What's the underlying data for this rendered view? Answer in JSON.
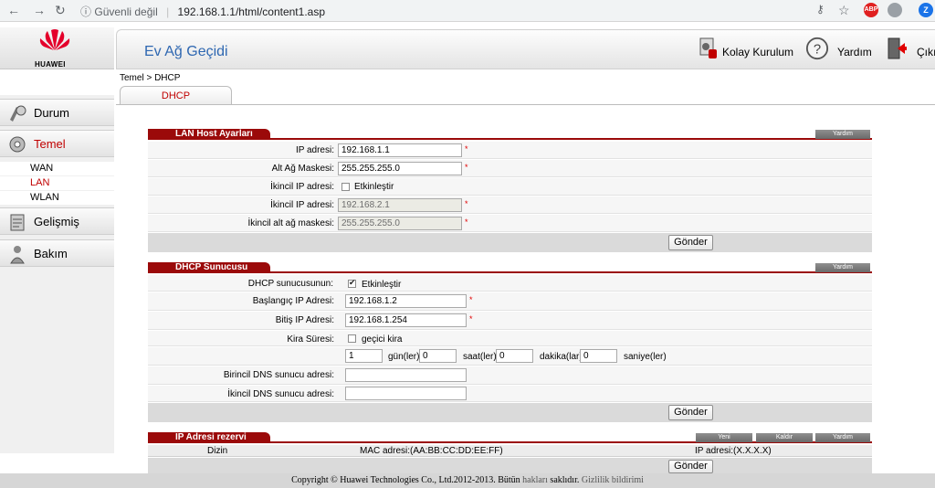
{
  "browser": {
    "security": "Güvenli değil",
    "url": "192.168.1.1/html/content1.asp",
    "profile_initial": "Z"
  },
  "header": {
    "logo_text": "HUAWEI",
    "title": "Ev Ağ Geçidi",
    "easy_setup": "Kolay Kurulum",
    "help": "Yardım",
    "logout": "Çıkış"
  },
  "breadcrumb": "Temel > DHCP",
  "tab": "DHCP",
  "sidebar": {
    "durum": "Durum",
    "temel": "Temel",
    "sub": [
      "WAN",
      "LAN",
      "WLAN"
    ],
    "gelismis": "Gelişmiş",
    "bakim": "Bakım"
  },
  "lan": {
    "title": "LAN Host Ayarları",
    "help": "Yardım",
    "ip_label": "IP adresi:",
    "ip_value": "192.168.1.1",
    "mask_label": "Alt Ağ Maskesi:",
    "mask_value": "255.255.255.0",
    "sec_ip_label": "İkincil IP adresi:",
    "enable": "Etkinleştir",
    "sec_ip2_label": "İkincil IP adresi:",
    "sec_ip2_value": "192.168.2.1",
    "sec_mask_label": "İkincil alt ağ maskesi:",
    "sec_mask_value": "255.255.255.0",
    "submit": "Gönder",
    "star": "*"
  },
  "dhcp": {
    "title": "DHCP Sunucusu",
    "help": "Yardım",
    "server_label": "DHCP sunucusunun:",
    "enable": "Etkinleştir",
    "start_label": "Başlangıç IP Adresi:",
    "start_value": "192.168.1.2",
    "end_label": "Bitiş IP Adresi:",
    "end_value": "192.168.1.254",
    "lease_label": "Kira Süresi:",
    "temp_lease": "geçici kira",
    "days_value": "1",
    "days_label": "gün(ler)",
    "hours_value": "0",
    "hours_label": "saat(ler)",
    "minutes_value": "0",
    "minutes_label": "dakika(lar)",
    "seconds_value": "0",
    "seconds_label": "saniye(ler)",
    "dns1_label": "Birincil DNS sunucu adresi:",
    "dns1_value": "",
    "dns2_label": "İkincil DNS sunucu adresi:",
    "dns2_value": "",
    "submit": "Gönder",
    "star": "*"
  },
  "reserve": {
    "title": "IP Adresi rezervi",
    "new": "Yeni",
    "remove": "Kaldır",
    "help": "Yardım",
    "col_index": "Dizin",
    "col_mac": "MAC adresi:(AA:BB:CC:DD:EE:FF)",
    "col_ip": "IP adresi:(X.X.X.X)",
    "submit": "Gönder"
  },
  "footer": {
    "copyright": "Copyright © Huawei Technologies Co., Ltd.2012-2013. Bütün",
    "rights": "hakları",
    "rights2": "saklıdır.",
    "privacy": "Gizlilik bildirimi"
  }
}
